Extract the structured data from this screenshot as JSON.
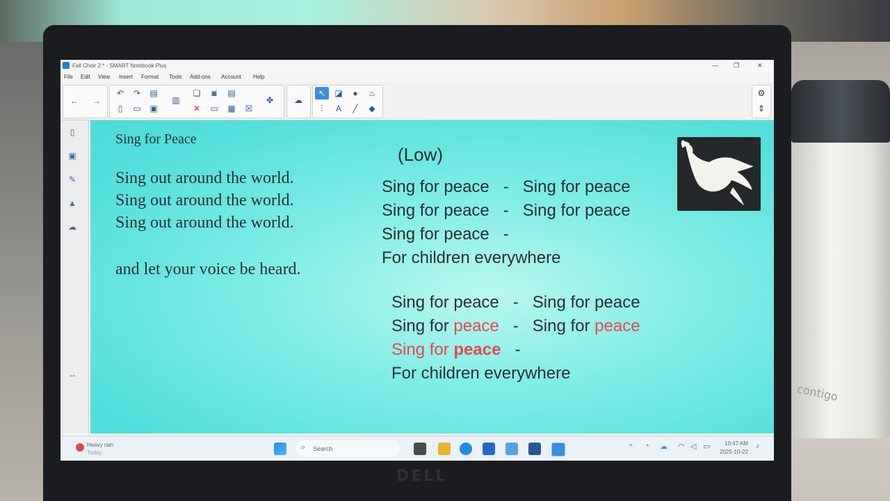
{
  "window": {
    "title": "Fall Choir 2 * - SMART Notebook Plus"
  },
  "menu": [
    "File",
    "Edit",
    "View",
    "Insert",
    "Format",
    "Tools",
    "Add-ons",
    "Account",
    "Help"
  ],
  "page": {
    "title": "Sing for Peace",
    "left_lines": [
      "Sing out around the world.",
      "Sing out around the world.",
      "Sing out around the world.",
      "and let your voice be heard."
    ],
    "low_label": "(Low)",
    "verse1": {
      "line1": "Sing for peace   -   Sing for peace",
      "line2": "Sing for peace   -   Sing for peace",
      "line3": "Sing for peace   -",
      "line4": "For children everywhere"
    },
    "verse2": {
      "line1": "Sing for peace   -   Sing for peace",
      "line2_a": "Sing for ",
      "line2_b": "peace",
      "line2_c": "   -   Sing for ",
      "line2_d": "peace",
      "line3_a": "Sing for ",
      "line3_b": "peace",
      "line3_c": "   -",
      "line4": "For children everywhere"
    }
  },
  "taskbar": {
    "weather_title": "Heavy rain",
    "weather_sub": "Today",
    "search_placeholder": "Search",
    "time": "10:47 AM",
    "date": "2025-10-22"
  },
  "other": {
    "laptop_brand": "DELL",
    "cup_brand": "contigo"
  },
  "colors": {
    "canvas": "#4cdcd8",
    "highlight": "#e2494f",
    "text": "#2b2e32"
  }
}
